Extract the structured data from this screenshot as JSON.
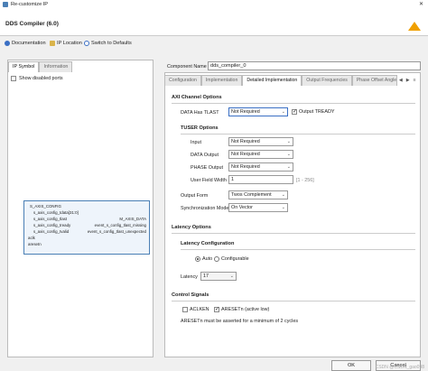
{
  "window": {
    "title": "Re-customize IP",
    "dialog_title": "DDS Compiler (6.0)"
  },
  "toolbar": {
    "documentation": "Documentation",
    "ip_location": "IP Location",
    "switch_defaults": "Switch to Defaults"
  },
  "left": {
    "tabs": [
      "IP Symbol",
      "Information"
    ],
    "show_disabled_ports": "Show disabled ports",
    "symbol": {
      "left_ports": [
        "S_AXIS_CONFIG",
        "s_axis_config_tdata[31:0]",
        "s_axis_config_tlast",
        "s_axis_config_tready",
        "s_axis_config_tvalid",
        "aclk",
        "aresetn"
      ],
      "right_ports": [
        "M_AXIS_DATA",
        "event_s_config_tlast_missing",
        "event_s_config_tlast_unexpected"
      ]
    }
  },
  "component": {
    "label": "Component Name",
    "value": "dds_compiler_0"
  },
  "right": {
    "tabs": [
      "Configuration",
      "Implementation",
      "Detailed Implementation",
      "Output Frequencies",
      "Phase Offset Angle"
    ],
    "axi_channel_options": "AXI Channel Options",
    "data_has_tlast_label": "DATA Has TLAST",
    "data_has_tlast_value": "Not Required",
    "output_tready": "Output TREADY",
    "tuser_options": "TUSER Options",
    "input_label": "Input",
    "input_value": "Not Required",
    "data_output_label": "DATA Output",
    "data_output_value": "Not Required",
    "phase_output_label": "PHASE Output",
    "phase_output_value": "Not Required",
    "user_field_width_label": "User Field Width",
    "user_field_width_value": "1",
    "user_field_width_range": "[1 - 256]",
    "output_form_label": "Output Form",
    "output_form_value": "Twos Complement",
    "sync_mode_label": "Synchronization Mode",
    "sync_mode_value": "On Vector",
    "latency_options": "Latency Options",
    "latency_configuration": "Latency Configuration",
    "auto": "Auto",
    "configurable": "Configurable",
    "latency_label": "Latency",
    "latency_value": "17",
    "control_signals": "Control Signals",
    "aclken": "ACLKEN",
    "aresetn": "ARESETn (active low)",
    "aresetn_note": "ARESETn must be asserted for a minimum of 2 cycles"
  },
  "buttons": {
    "ok": "OK",
    "cancel": "Cancel"
  },
  "watermark": "CSDN @CSDN_gao098"
}
